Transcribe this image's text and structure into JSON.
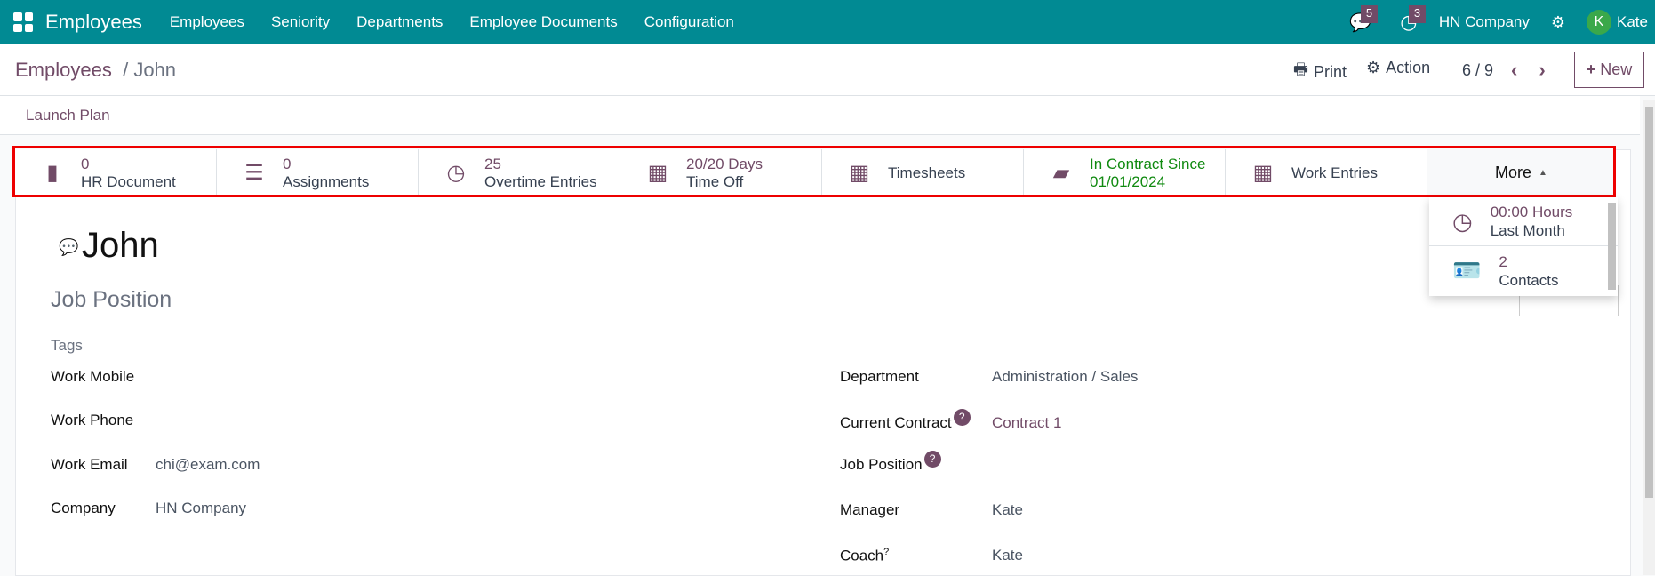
{
  "topbar": {
    "app": "Employees",
    "menu": [
      "Employees",
      "Seniority",
      "Departments",
      "Employee Documents",
      "Configuration"
    ],
    "messages_count": "5",
    "activities_count": "3",
    "company": "HN Company",
    "user_initial": "K",
    "user": "Kate"
  },
  "breadcrumb": {
    "parent": "Employees",
    "current": "John"
  },
  "toolbar": {
    "print": "Print",
    "action": "Action",
    "pager": "6 / 9",
    "new": "New"
  },
  "status": {
    "launch_plan": "Launch Plan"
  },
  "smart_buttons": [
    {
      "value": "0",
      "label": "HR Document",
      "icon": "file-icon"
    },
    {
      "value": "0",
      "label": "Assignments",
      "icon": "list-icon"
    },
    {
      "value": "25",
      "label": "Overtime Entries",
      "icon": "clock-icon"
    },
    {
      "value": "20/20 Days",
      "label": "Time Off",
      "icon": "calendar-icon"
    },
    {
      "value": "",
      "label": "Timesheets",
      "icon": "calendar-icon"
    },
    {
      "value": "In Contract Since",
      "label": "01/01/2024",
      "icon": "book-icon"
    },
    {
      "value": "",
      "label": "Work Entries",
      "icon": "calendar-icon"
    }
  ],
  "more": {
    "label": "More",
    "items": [
      {
        "value": "00:00 Hours",
        "label": "Last Month"
      },
      {
        "value": "2",
        "label": "Contacts"
      }
    ]
  },
  "employee": {
    "name": "John",
    "job_position_placeholder": "Job Position",
    "tags_placeholder": "Tags"
  },
  "left_fields": [
    {
      "label": "Work Mobile",
      "value": ""
    },
    {
      "label": "Work Phone",
      "value": ""
    },
    {
      "label": "Work Email",
      "value": "chi@exam.com"
    },
    {
      "label": "Company",
      "value": "HN Company"
    }
  ],
  "right_fields": [
    {
      "label": "Department",
      "value": "Administration / Sales"
    },
    {
      "label": "Current Contract",
      "value": "Contract 1",
      "help": "?"
    },
    {
      "label": "Job Position",
      "value": "",
      "help": "?"
    },
    {
      "label": "Manager",
      "value": "Kate"
    },
    {
      "label": "Coach",
      "value": "Kate",
      "help": "?"
    }
  ]
}
